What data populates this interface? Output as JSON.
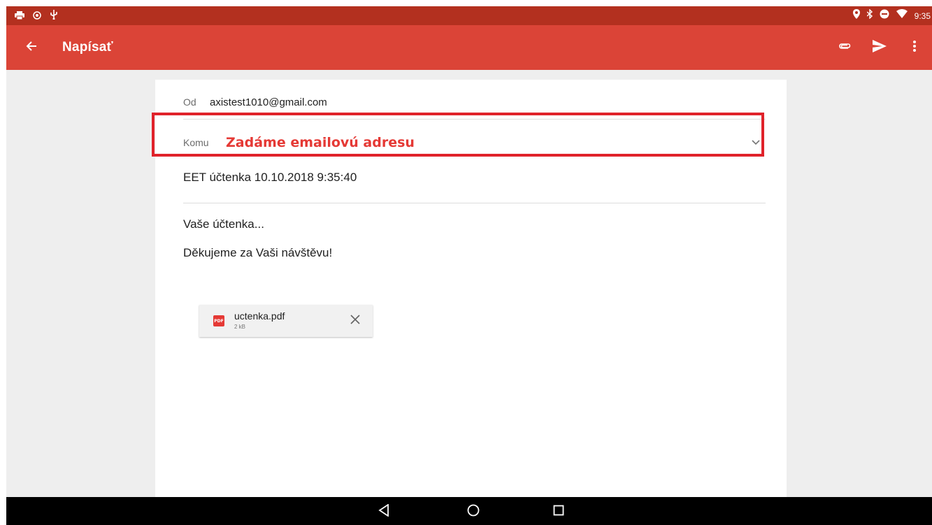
{
  "status_bar": {
    "time": "9:35",
    "left_icons": [
      "printer-icon",
      "location-shield-icon",
      "usb-icon"
    ],
    "right_icons": [
      "location-icon",
      "bluetooth-icon",
      "do-not-disturb-icon",
      "wifi-icon"
    ]
  },
  "app_bar": {
    "title": "Napísať",
    "actions": [
      "attach-icon",
      "send-icon",
      "more-vert-icon"
    ],
    "color": "#db4437"
  },
  "compose": {
    "from_label": "Od",
    "from_value": "axistest1010@gmail.com",
    "to_label": "Komu",
    "to_hint": "Zadáme emailovú adresu",
    "subject": "EET účtenka 10.10.2018 9:35:40",
    "body_lines": [
      "Vaše účtenka...",
      "Děkujeme za Vaši návštěvu!"
    ]
  },
  "attachment": {
    "name": "uctenka.pdf",
    "size": "2 kB",
    "type_badge": "PDF"
  },
  "colors": {
    "status_bar": "#b3301f",
    "highlight": "#e0222a",
    "hint_text": "#e53935"
  }
}
